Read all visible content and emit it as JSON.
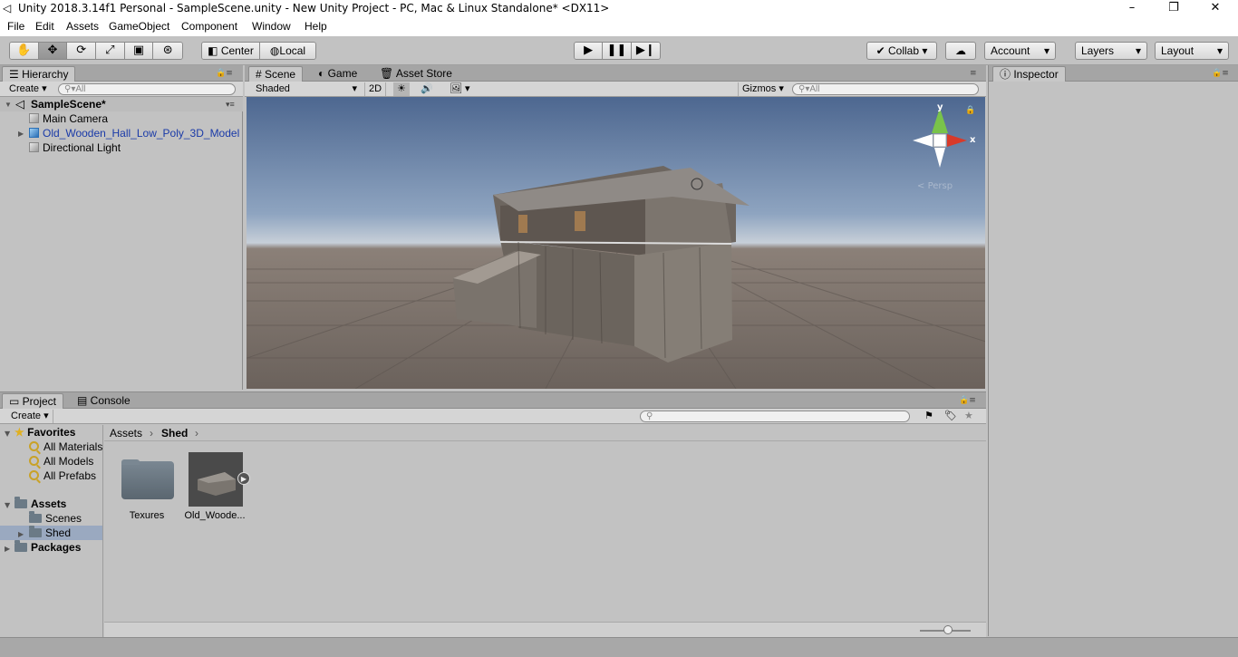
{
  "window": {
    "title": "Unity 2018.3.14f1 Personal - SampleScene.unity - New Unity Project - PC, Mac & Linux Standalone* <DX11>",
    "minimize": "–",
    "maximize": "❐",
    "close": "✕"
  },
  "menu": [
    "File",
    "Edit",
    "Assets",
    "GameObject",
    "Component",
    "Window",
    "Help"
  ],
  "toolbar": {
    "pivot": "Center",
    "space": "Local",
    "collab": "Collab",
    "account": "Account",
    "layers": "Layers",
    "layout": "Layout"
  },
  "hierarchy": {
    "tab": "Hierarchy",
    "create": "Create",
    "search_placeholder": "All",
    "scene": "SampleScene*",
    "items": [
      "Main Camera",
      "Old_Wooden_Hall_Low_Poly_3D_Model",
      "Directional Light"
    ]
  },
  "scene_view": {
    "tabs": [
      "Scene",
      "Game",
      "Asset Store"
    ],
    "shading": "Shaded",
    "mode_2d": "2D",
    "gizmos": "Gizmos",
    "search_placeholder": "All",
    "axis_y": "y",
    "axis_x": "x",
    "persp": "Persp"
  },
  "inspector": {
    "tab": "Inspector"
  },
  "project": {
    "tabs": [
      "Project",
      "Console"
    ],
    "create": "Create",
    "favorites_label": "Favorites",
    "favorites": [
      "All Materials",
      "All Models",
      "All Prefabs"
    ],
    "assets_label": "Assets",
    "asset_folders": [
      "Scenes",
      "Shed"
    ],
    "packages_label": "Packages",
    "breadcrumb": [
      "Assets",
      "Shed"
    ],
    "items": [
      "Texures",
      "Old_Woode..."
    ]
  },
  "colors": {
    "sky_top": "#4f6a8f",
    "ground": "#6b625c",
    "selection": "#9aa9c0"
  }
}
